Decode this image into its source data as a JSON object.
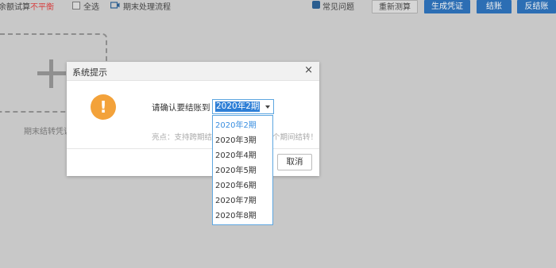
{
  "topbar": {
    "balance_label": "余额试算",
    "balance_status": "不平衡",
    "select_all": "全选",
    "period_flow": "期末处理流程",
    "help": "常见问题",
    "btn_recalc": "重新测算",
    "btn_voucher": "生成凭证",
    "btn_close": "结账",
    "btn_reverse": "反结账"
  },
  "background": {
    "caption": "期末结转凭证"
  },
  "dialog": {
    "title": "系统提示",
    "close": "×",
    "warn_glyph": "!",
    "confirm_label": "请确认要结账到",
    "selected_period": "2020年2期",
    "tip": "亮点：支持跨期结账，会自动完成每个期间结转！",
    "cancel": "取消"
  },
  "dropdown": {
    "options": [
      "2020年2期",
      "2020年3期",
      "2020年4期",
      "2020年5期",
      "2020年6期",
      "2020年7期",
      "2020年8期"
    ]
  },
  "colors": {
    "primary_blue": "#2c6eb4",
    "warn_orange": "#f3a23a",
    "highlight_blue": "#2f7fd6",
    "error_red": "#d64040"
  }
}
